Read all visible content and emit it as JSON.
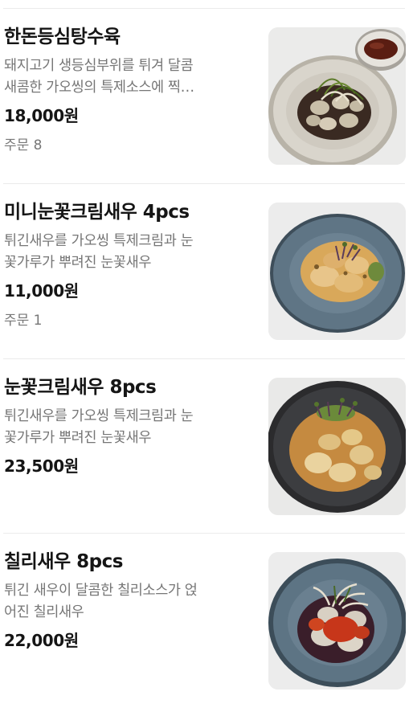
{
  "menu": {
    "items": [
      {
        "name": "한돈등심탕수육",
        "desc_line1": "돼지고기 생등심부위를 튀겨 달콤",
        "desc_line2": "새콤한 가오씽의 특제소스에 찍…",
        "price": "18,000원",
        "orders": "주문 8",
        "image_icon": "dish-photo-sweet-sour-pork"
      },
      {
        "name": "미니눈꽃크림새우 4pcs",
        "desc_line1": "튀긴새우를 가오씽 특제크림과 눈",
        "desc_line2": "꽃가루가 뿌려진 눈꽃새우",
        "price": "11,000원",
        "orders": "주문 1",
        "image_icon": "dish-photo-cream-shrimp"
      },
      {
        "name": "눈꽃크림새우 8pcs",
        "desc_line1": "튀긴새우를 가오씽 특제크림과 눈",
        "desc_line2": "꽃가루가 뿌려진 눈꽃새우",
        "price": "23,500원",
        "orders": "",
        "image_icon": "dish-photo-cream-shrimp-large"
      },
      {
        "name": "칠리새우 8pcs",
        "desc_line1": "튀긴 새우이 달콤한 칠리소스가 얹",
        "desc_line2": "어진 칠리새우",
        "price": "22,000원",
        "orders": "",
        "image_icon": "dish-photo-chili-shrimp"
      }
    ]
  }
}
